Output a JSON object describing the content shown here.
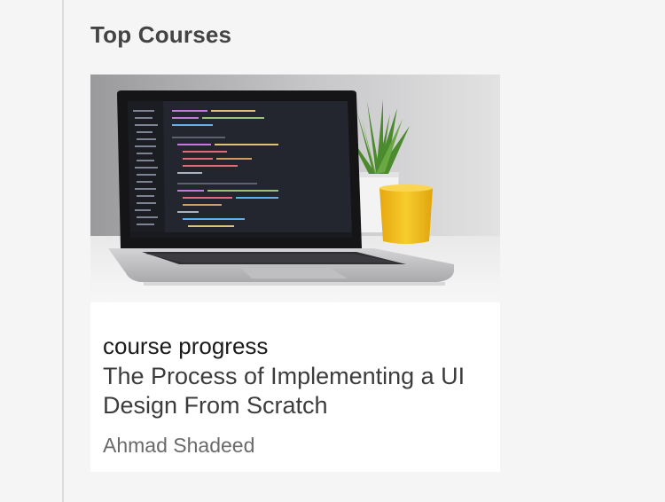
{
  "section": {
    "title": "Top Courses"
  },
  "course": {
    "thumbnail_icon": "laptop-code-photo",
    "progress_label": "course progress",
    "title": "The Process of Implementing a UI Design From Scratch",
    "author": "Ahmad Shadeed"
  },
  "colors": {
    "background": "#f5f5f5",
    "card": "#ffffff",
    "heading": "#444444",
    "author": "#6a6a6a"
  }
}
